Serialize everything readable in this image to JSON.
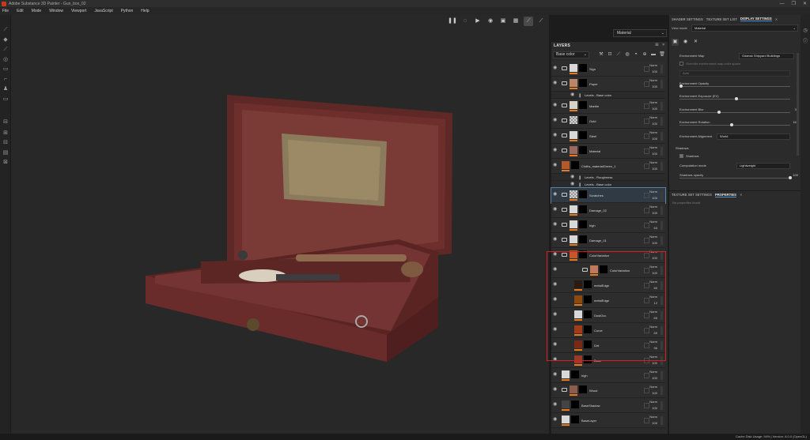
{
  "window": {
    "title": "Adobe Substance 3D Painter - Gun_box_02",
    "buttons": [
      "—",
      "❐",
      "✕"
    ]
  },
  "menu": [
    "File",
    "Edit",
    "Mode",
    "Window",
    "Viewport",
    "JavaScript",
    "Python",
    "Help"
  ],
  "viewport": {
    "material_dropdown": "Material"
  },
  "layers": {
    "header": "LAYERS",
    "channel": "Base color",
    "items": [
      {
        "name": "Sign",
        "blend": "Norm",
        "opacity": "100",
        "kind": "folder",
        "thumb": "#d8d8d8"
      },
      {
        "name": "Paper",
        "blend": "Norm",
        "opacity": "100",
        "kind": "folder",
        "thumb": "#b9876a"
      },
      {
        "name": "Levels - Base color",
        "kind": "sub"
      },
      {
        "name": "Marble",
        "blend": "Norm",
        "opacity": "100",
        "kind": "folder",
        "thumb": "#d7d2c7"
      },
      {
        "name": "Gold",
        "blend": "Norm",
        "opacity": "100",
        "kind": "folder",
        "thumb": "checker"
      },
      {
        "name": "Steel",
        "blend": "Norm",
        "opacity": "100",
        "kind": "folder",
        "thumb": "#d8d8d8"
      },
      {
        "name": "Material",
        "blend": "Norm",
        "opacity": "100",
        "kind": "folder",
        "thumb": "#9a6a5e"
      },
      {
        "name": "Cloths_materialGreen_1",
        "blend": "Norm",
        "opacity": "100",
        "kind": "layer",
        "thumb": "#b25a2c"
      },
      {
        "name": "Levels - Roughness",
        "kind": "sub"
      },
      {
        "name": "Levels - Base color",
        "kind": "sub"
      },
      {
        "name": "Scratches",
        "blend": "Norm",
        "opacity": "100",
        "kind": "folder",
        "thumb": "checker"
      },
      {
        "name": "Damage_02",
        "blend": "Norm",
        "opacity": "100",
        "kind": "folder",
        "thumb": "#d8d8d8"
      },
      {
        "name": "high",
        "blend": "Norm",
        "opacity": "63",
        "kind": "folder",
        "thumb": "#d8d8d8"
      },
      {
        "name": "Damage_01",
        "blend": "Norm",
        "opacity": "100",
        "kind": "folder",
        "thumb": "#d8d8d8"
      },
      {
        "name": "ColorVariation",
        "blend": "Norm",
        "opacity": "100",
        "kind": "folder",
        "thumb": "#c7562a"
      },
      {
        "name": "ColorVariation",
        "blend": "Norm",
        "opacity": "100",
        "kind": "folder2",
        "thumb": "#c07a5c"
      },
      {
        "name": "metalEdge",
        "blend": "Norm",
        "opacity": "60",
        "kind": "fill",
        "thumb": "#2a1a12"
      },
      {
        "name": "metalEdge",
        "blend": "Norm",
        "opacity": "12",
        "kind": "fill",
        "thumb": "#8c4a0e"
      },
      {
        "name": "DustOcc",
        "blend": "Norm",
        "opacity": "69",
        "kind": "fill",
        "thumb": "#d8d8d8"
      },
      {
        "name": "Curve",
        "blend": "Norm",
        "opacity": "69",
        "kind": "fill",
        "thumb": "#a33a1a"
      },
      {
        "name": "Dirt",
        "blend": "Norm",
        "opacity": "96",
        "kind": "fill",
        "thumb": "#7a2a14"
      },
      {
        "name": "Base",
        "blend": "Norm",
        "opacity": "100",
        "kind": "fill",
        "thumb": "#9b3a28"
      },
      {
        "name": "high",
        "blend": "Norm",
        "opacity": "100",
        "kind": "layer",
        "thumb": "#d8d8d8"
      },
      {
        "name": "Wood",
        "blend": "Norm",
        "opacity": "100",
        "kind": "folder",
        "thumb": "#8c5c4c"
      },
      {
        "name": "BaseShadow",
        "blend": "Norm",
        "opacity": "100",
        "kind": "layer",
        "thumb": "#444"
      },
      {
        "name": "BaseLayer",
        "blend": "Norm",
        "opacity": "100",
        "kind": "layer",
        "thumb": "#d8d8d8"
      }
    ]
  },
  "right_panel": {
    "tabs": [
      "SHADER SETTINGS",
      "TEXTURE SET LIST",
      "DISPLAY SETTINGS"
    ],
    "view_mode_label": "View mode",
    "view_mode_value": "Material",
    "env_map_label": "Environment Map",
    "env_map_value": "Gdansk Shipyard Buildings",
    "override_label": "Override environment map color space",
    "override_value": "Auto",
    "settings": [
      {
        "label": "Environment Opacity",
        "value": "0"
      },
      {
        "label": "Environment Exposure (EV)",
        "value": "0"
      },
      {
        "label": "Environment Blur",
        "value": "30"
      },
      {
        "label": "Environment Rotation",
        "value": "167"
      }
    ],
    "env_alignment_label": "Environment Alignment",
    "env_alignment_value": "World",
    "shadows_section": "Shadows",
    "shadows_checkbox": "Shadows",
    "computation_label": "Computation mode",
    "computation_value": "Lightweight",
    "shadows_opacity_label": "Shadows opacity",
    "shadows_opacity_value": "100",
    "lower_tabs": [
      "TEXTURE SET SETTINGS",
      "PROPERTIES"
    ],
    "no_properties": "No properties found"
  },
  "status": "Cache Disk Usage: 94% | Version: 8.0.0 (OpenGL)"
}
